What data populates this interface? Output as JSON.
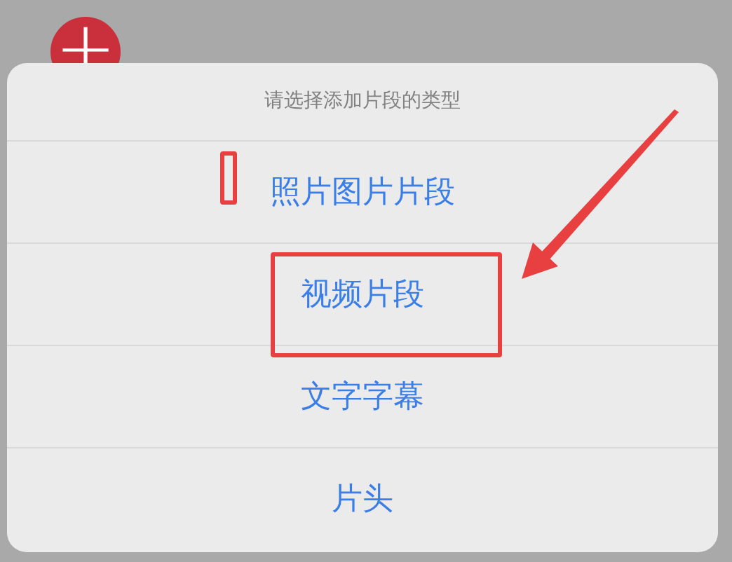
{
  "add_button": {
    "label": "+"
  },
  "action_sheet": {
    "title": "请选择添加片段的类型",
    "options": [
      {
        "label": "照片图片片段",
        "highlighted": false
      },
      {
        "label": "视频片段",
        "highlighted": true
      },
      {
        "label": "文字字幕",
        "highlighted": false
      },
      {
        "label": "片头",
        "highlighted": false
      }
    ]
  }
}
